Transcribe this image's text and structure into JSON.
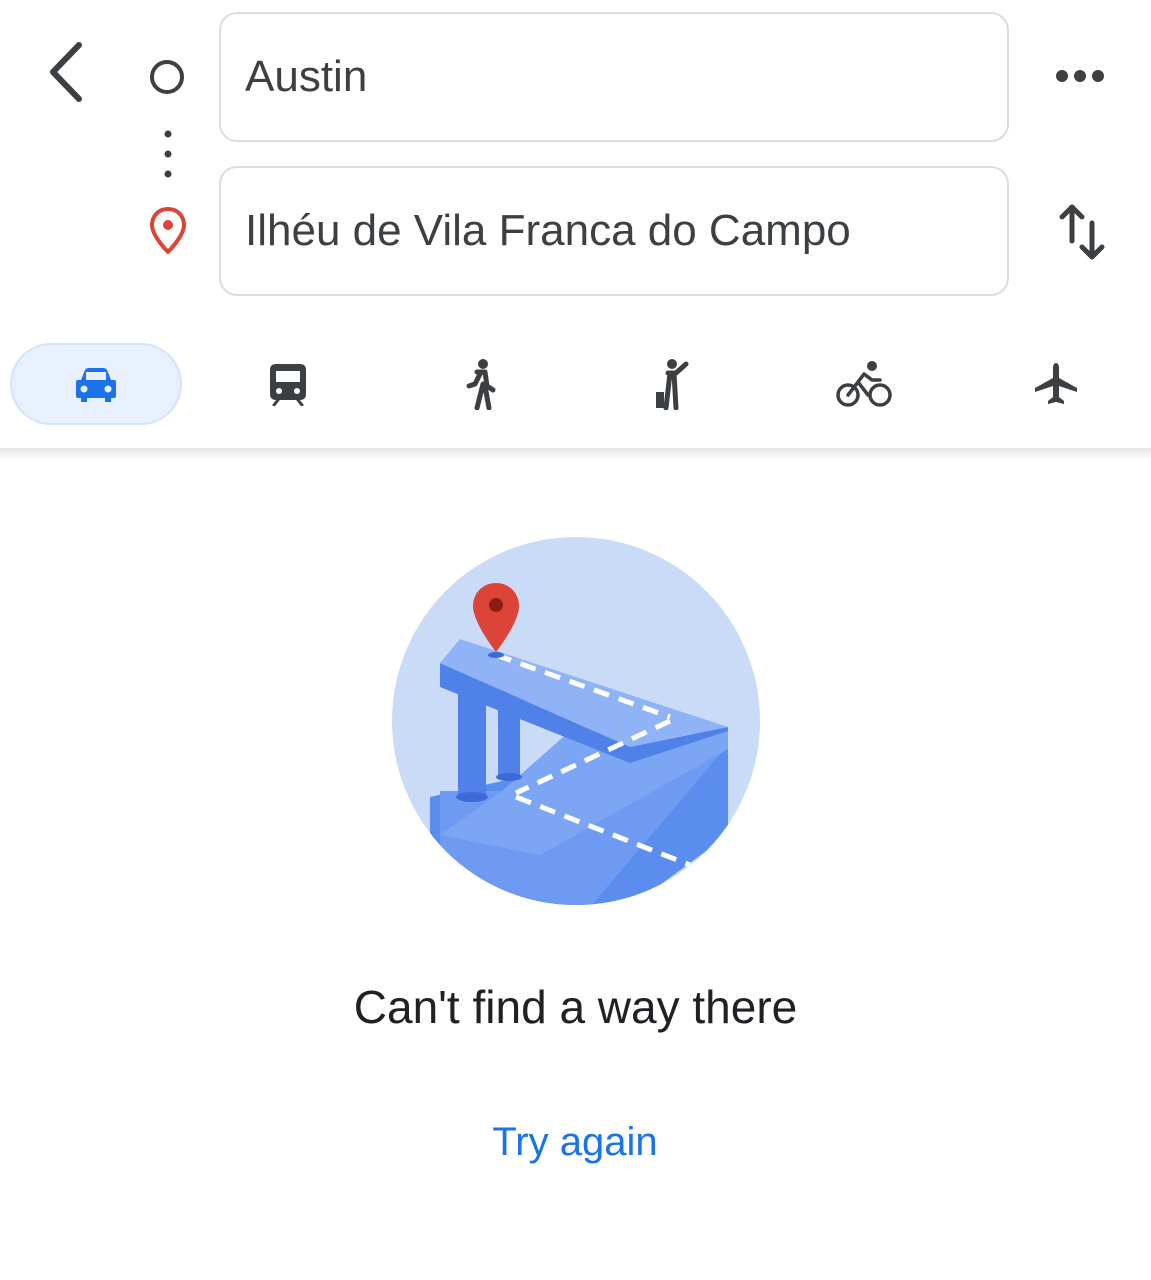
{
  "directions": {
    "origin": {
      "value": "Austin"
    },
    "destination": {
      "value": "Ilhéu de Vila Franca do Campo"
    }
  },
  "header": {
    "back_icon": "chevron-left-icon",
    "more_icon": "more-horizontal-icon",
    "swap_icon": "swap-vertical-icon"
  },
  "modes": [
    {
      "name": "drive",
      "icon": "car-icon",
      "selected": true
    },
    {
      "name": "transit",
      "icon": "train-icon",
      "selected": false
    },
    {
      "name": "walk",
      "icon": "walking-icon",
      "selected": false
    },
    {
      "name": "ride-hail",
      "icon": "ride-hail-icon",
      "selected": false
    },
    {
      "name": "bike",
      "icon": "bicycle-icon",
      "selected": false
    },
    {
      "name": "flight",
      "icon": "airplane-icon",
      "selected": false
    }
  ],
  "empty_state": {
    "message": "Can't find a way there",
    "action_label": "Try again"
  },
  "colors": {
    "accent": "#1a73e8",
    "active_tab_bg": "#e8f0fe",
    "pin_red": "#db4437",
    "icon_gray": "#3c4043"
  }
}
